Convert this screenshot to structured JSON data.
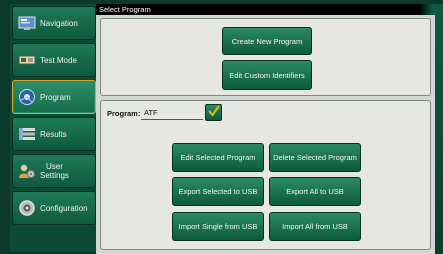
{
  "sidebar": {
    "items": [
      {
        "label": "Navigation",
        "icon": "navigation-icon",
        "active": false
      },
      {
        "label": "Test Mode",
        "icon": "test-mode-icon",
        "active": false
      },
      {
        "label": "Program",
        "icon": "program-icon",
        "active": true
      },
      {
        "label": "Results",
        "icon": "results-icon",
        "active": false
      },
      {
        "label_line1": "User",
        "label_line2": "Settings",
        "icon": "user-settings-icon",
        "active": false
      },
      {
        "label": "Configuration",
        "icon": "configuration-icon",
        "active": false
      }
    ]
  },
  "window": {
    "title": "Select Program"
  },
  "top_panel": {
    "create_button": "Create New Program",
    "edit_identifiers_button": "Edit Custom Identifiers"
  },
  "program": {
    "label": "Program:",
    "selected_value": "ATF"
  },
  "actions": {
    "edit_selected": "Edit Selected Program",
    "delete_selected": "Delete Selected Program",
    "export_selected_usb": "Export Selected to USB",
    "export_all_usb": "Export All to USB",
    "import_single_usb": "Import Single from USB",
    "import_all_usb": "Import All from USB"
  },
  "colors": {
    "accent_green": "#1f7a58",
    "active_border": "#d9a531",
    "checkmark": "#f0b020"
  }
}
